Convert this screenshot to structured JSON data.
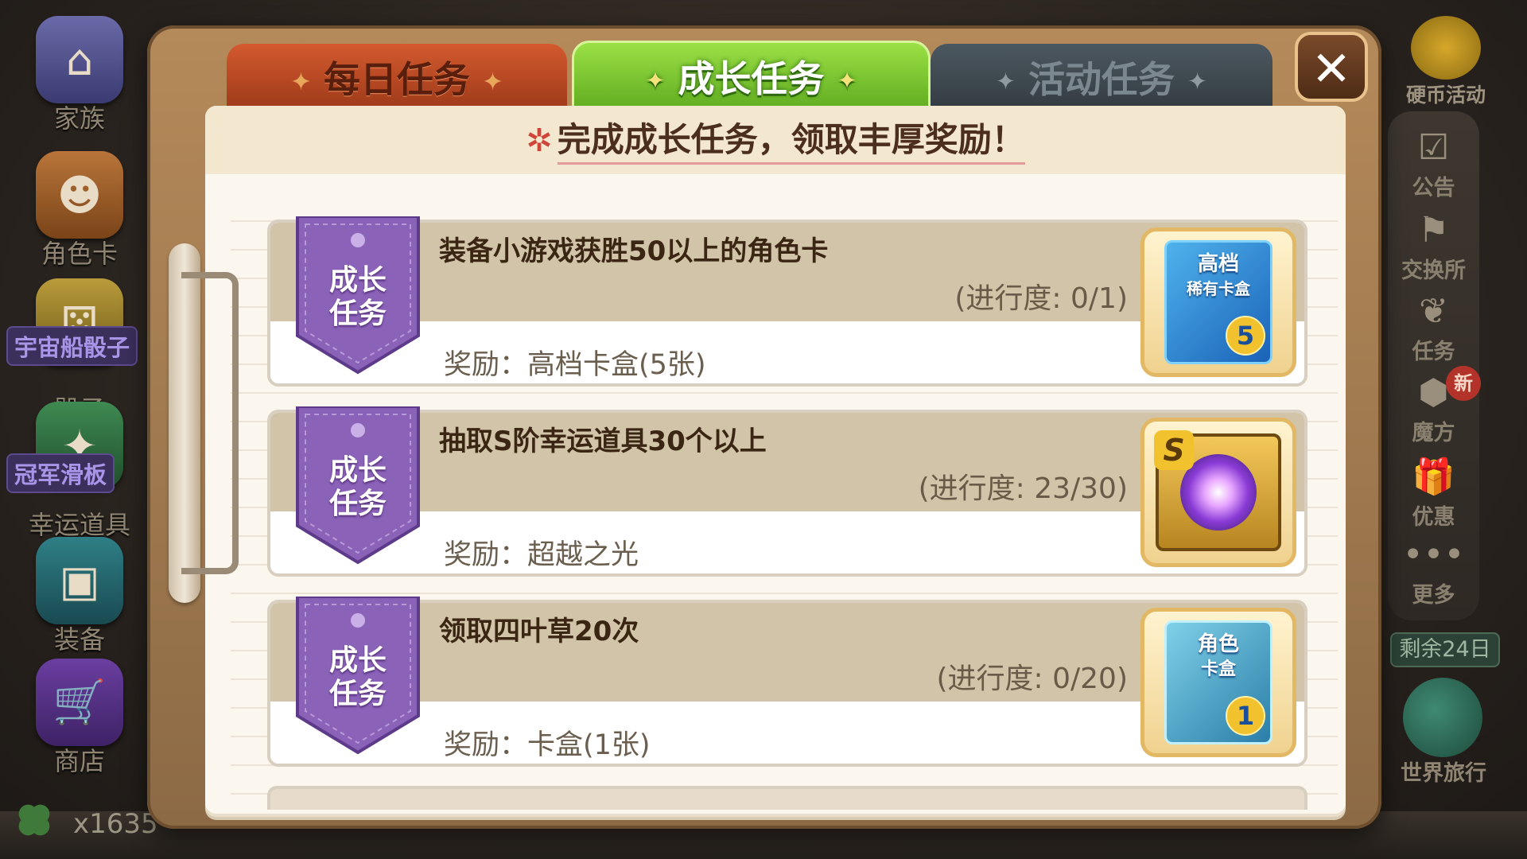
{
  "left_menu": {
    "family": "家族",
    "role_card": "角色卡",
    "spaceship_badge": "宇宙船骰子",
    "dice": "骰子",
    "skate_badge": "冠军滑板",
    "lucky_item": "幸运道具",
    "equipment": "装备",
    "shop": "商店"
  },
  "bottom": {
    "clover_count": "x1635"
  },
  "right_menu": {
    "coin_event": "硬币活动",
    "notice": "公告",
    "exchange": "交换所",
    "tasks": "任务",
    "cube": "魔方",
    "new_badge": "新",
    "deals": "优惠",
    "more_dots": "•••",
    "more": "更多",
    "days_left": "剩余24日",
    "world_travel": "世界旅行"
  },
  "dialog": {
    "tabs": [
      {
        "label": "每日任务",
        "active": false
      },
      {
        "label": "成长任务",
        "active": true
      },
      {
        "label": "活动任务",
        "active": false
      }
    ],
    "close_symbol": "✕",
    "header": "完成成长任务，领取丰厚奖励！",
    "ribbon_line1": "成长",
    "ribbon_line2": "任务",
    "tasks": [
      {
        "title": "装备小游戏获胜50以上的角色卡",
        "progress": "(进行度: 0/1)",
        "reward": "奖励：高档卡盒(5张)",
        "item": {
          "text1": "高档",
          "text2": "稀有卡盒",
          "number": "5"
        }
      },
      {
        "title": "抽取S阶幸运道具30个以上",
        "progress": "(进行度: 23/30)",
        "reward": "奖励：超越之光",
        "item": {
          "s_mark": "S"
        }
      },
      {
        "title": "领取四叶草20次",
        "progress": "(进行度: 0/20)",
        "reward": "奖励：卡盒(1张)",
        "item": {
          "text1": "角色",
          "text2": "卡盒",
          "number": "1"
        }
      }
    ]
  },
  "colors": {
    "active_tab": "#7cc830",
    "daily_tab": "#c24a22",
    "event_tab": "#3f4a52",
    "ribbon": "#8a62b8",
    "card_band": "#d2c4a9"
  }
}
